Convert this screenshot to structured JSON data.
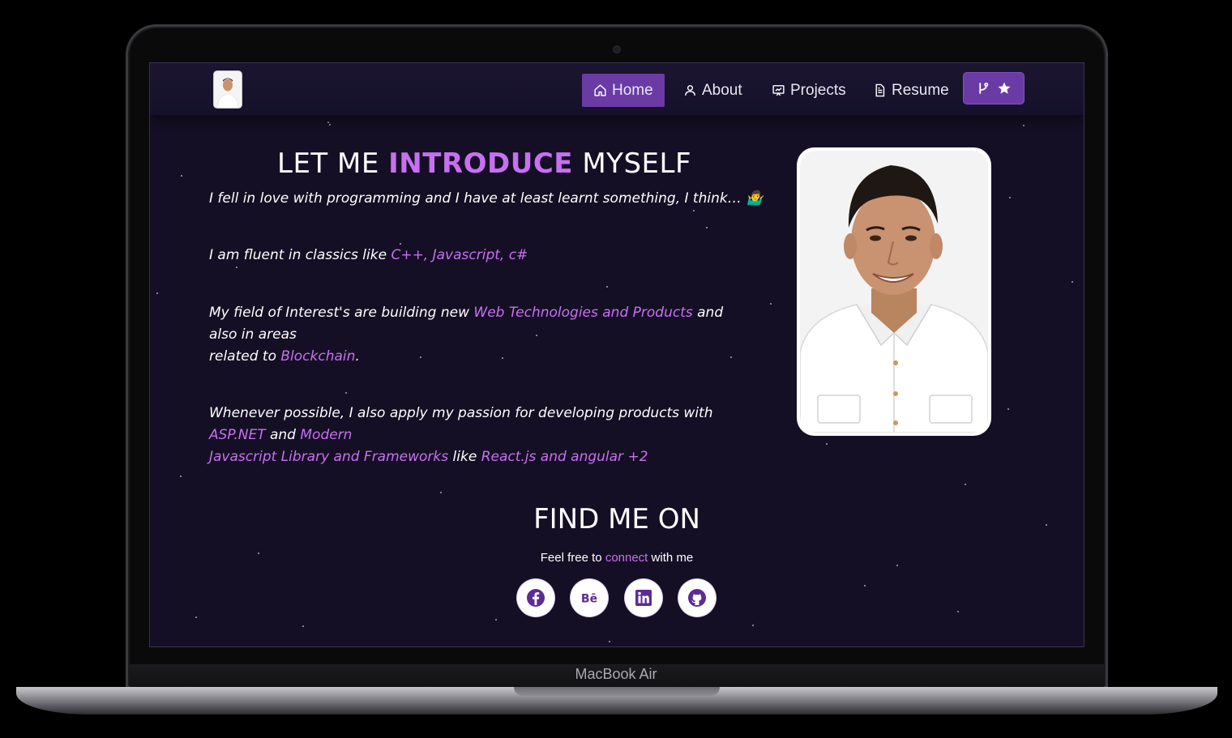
{
  "device": {
    "label": "MacBook Air"
  },
  "nav": {
    "items": [
      {
        "label": "Home",
        "icon": "home-icon",
        "active": true
      },
      {
        "label": "About",
        "icon": "user-icon"
      },
      {
        "label": "Projects",
        "icon": "projects-icon"
      },
      {
        "label": "Resume",
        "icon": "document-icon"
      }
    ],
    "fork_button": {
      "icons": [
        "git-fork-icon",
        "star-icon"
      ]
    }
  },
  "intro": {
    "title_pre": "LET ME ",
    "title_accent": "INTRODUCE",
    "title_post": " MYSELF",
    "line1": "I fell in love with programming and I have at least learnt something, I think… 🤷‍♂️",
    "line2_pre": "I am fluent in classics like ",
    "line2_hl": "C++, Javascript, c#",
    "line3_pre": "My field of Interest's are building new ",
    "line3_hl": "Web Technologies and Products",
    "line3_mid": " and also in areas",
    "line3_post_pre": "related to ",
    "line3_post_hl": "Blockchain",
    "line3_end": ".",
    "line4_pre": "Whenever possible, I also apply my passion for developing products with",
    "line4_hl1": "ASP.NET",
    "line4_and": " and ",
    "line4_hl2": "Modern",
    "line4_hl3": "Javascript Library and Frameworks",
    "line4_like": " like ",
    "line4_hl4": "React.js and angular +2"
  },
  "find": {
    "title": "FIND ME ON",
    "text_pre": "Feel free to ",
    "text_hl": "connect",
    "text_post": " with me",
    "socials": [
      "facebook-icon",
      "behance-icon",
      "linkedin-icon",
      "github-icon"
    ]
  },
  "colors": {
    "accent": "#c770f0",
    "nav_active": "#6a3aa5",
    "background": "#150f25"
  }
}
